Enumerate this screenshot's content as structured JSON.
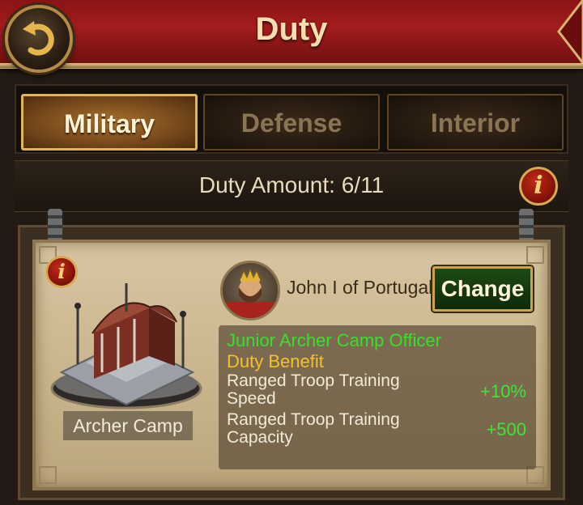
{
  "header": {
    "title": "Duty",
    "back_icon": "back-arrow-icon",
    "accent_color": "#9e1b1b"
  },
  "tabs": [
    {
      "label": "Military",
      "active": true
    },
    {
      "label": "Defense",
      "active": false
    },
    {
      "label": "Interior",
      "active": false
    }
  ],
  "duty_amount": {
    "label": "Duty Amount: 6/11",
    "info_icon": "info-icon"
  },
  "card": {
    "building_label": "Archer Camp",
    "info_icon": "info-icon",
    "officer_name": "John I of Portugal",
    "change_label": "Change",
    "officer_title": "Junior Archer Camp Officer",
    "benefit_title": "Duty Benefit",
    "benefits": [
      {
        "name": "Ranged Troop Training Speed",
        "value": "+10%"
      },
      {
        "name": "Ranged Troop Training Capacity",
        "value": "+500"
      }
    ]
  }
}
